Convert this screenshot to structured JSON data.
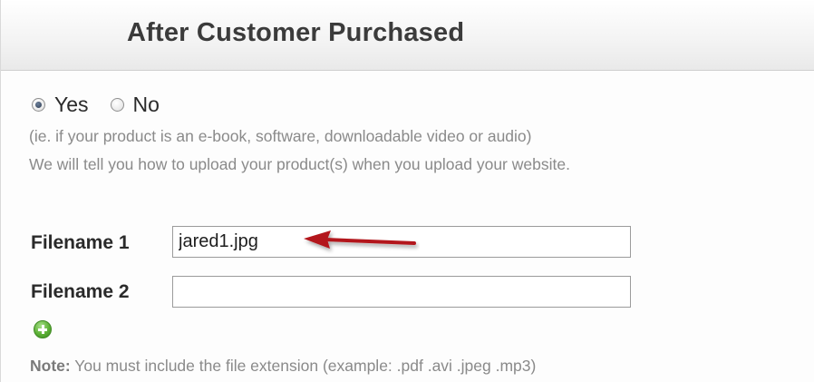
{
  "panel": {
    "title": "After Customer Purchased"
  },
  "choice": {
    "yes_label": "Yes",
    "no_label": "No",
    "selected": "Yes"
  },
  "hints": {
    "line1": "(ie. if your product is an e-book, software, downloadable video or audio)",
    "line2": "We will tell you how to upload your product(s) when you upload your website."
  },
  "files": {
    "filename1_label": "Filename 1",
    "filename1_value": "jared1.jpg",
    "filename2_label": "Filename 2",
    "filename2_value": ""
  },
  "icons": {
    "add": "plus-circle-icon",
    "pointer": "red-arrow-icon"
  },
  "note": {
    "prefix": "Note:",
    "text": " You must include the file extension (example: .pdf .avi .jpeg .mp3)"
  },
  "colors": {
    "arrow": "#b3181b",
    "add_button": "#5cb036",
    "title_text": "#3b3b3b",
    "hint_text": "#8a8a8a"
  }
}
